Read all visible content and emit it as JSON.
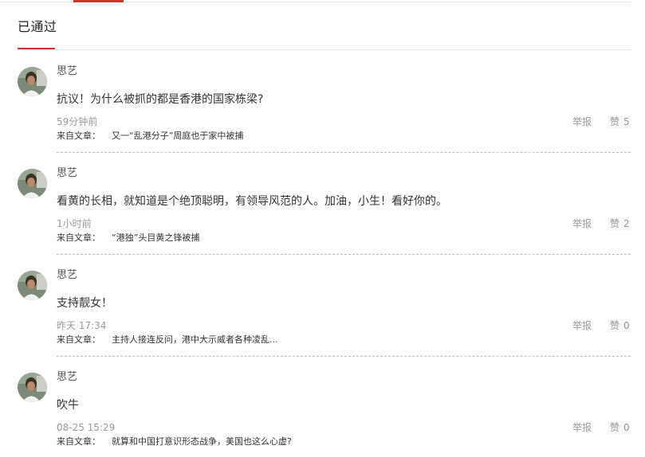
{
  "section": {
    "title": "已通过"
  },
  "colors": {
    "accent": "#d0342c",
    "divider": "#e6e6e6",
    "muted_text": "#999999",
    "body_text": "#333333"
  },
  "comments": [
    {
      "username": "思艺",
      "text": "抗议！为什么被抓的都是香港的国家栋梁?",
      "time": "59分钟前",
      "source_label": "来自文章：",
      "source_title": "又一“乱港分子”周庭也于家中被捕",
      "report_label": "举报",
      "like_label": "赞",
      "like_count": "5",
      "avatar_icon": "user-avatar-icon"
    },
    {
      "username": "思艺",
      "text": "看黄的长相，就知道是个绝顶聪明，有领导风范的人。加油，小生！看好你的。",
      "time": "1小时前",
      "source_label": "来自文章：",
      "source_title": "“港独”头目黄之锋被捕",
      "report_label": "举报",
      "like_label": "赞",
      "like_count": "2",
      "avatar_icon": "user-avatar-icon"
    },
    {
      "username": "思艺",
      "text": "支持靓女！",
      "time": "昨天 17:34",
      "source_label": "来自文章：",
      "source_title": "主持人接连反问，港中大示威者各种凌乱...",
      "report_label": "举报",
      "like_label": "赞",
      "like_count": "0",
      "avatar_icon": "user-avatar-icon"
    },
    {
      "username": "思艺",
      "text": "吹牛",
      "time": "08-25 15:29",
      "source_label": "来自文章：",
      "source_title": "就算和中国打意识形态战争，美国也这么心虚?",
      "report_label": "举报",
      "like_label": "赞",
      "like_count": "0",
      "avatar_icon": "user-avatar-icon"
    }
  ]
}
